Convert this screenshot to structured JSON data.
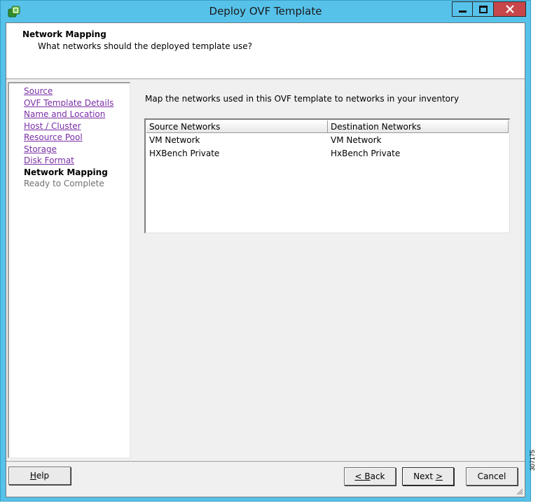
{
  "window": {
    "title": "Deploy OVF Template",
    "controls": {
      "minimize": "minimize",
      "maximize": "maximize",
      "close": "close"
    },
    "colors": {
      "titlebar": "#56c2ea",
      "close": "#c7464a",
      "link": "#7a2ea6"
    }
  },
  "header": {
    "title": "Network Mapping",
    "subtitle": "What networks should the deployed template use?"
  },
  "steps": [
    {
      "label": "Source",
      "state": "link"
    },
    {
      "label": "OVF Template Details",
      "state": "link"
    },
    {
      "label": "Name and Location",
      "state": "link"
    },
    {
      "label": "Host / Cluster",
      "state": "link"
    },
    {
      "label": "Resource Pool",
      "state": "link"
    },
    {
      "label": "Storage",
      "state": "link"
    },
    {
      "label": "Disk Format",
      "state": "link"
    },
    {
      "label": "Network Mapping",
      "state": "current"
    },
    {
      "label": "Ready to Complete",
      "state": "pending"
    }
  ],
  "content": {
    "instructions": "Map the networks used in this OVF template to networks in your inventory",
    "table": {
      "columns": [
        "Source Networks",
        "Destination Networks"
      ],
      "rows": [
        [
          "VM Network",
          "VM Network"
        ],
        [
          "HXBench Private",
          "HxBench Private"
        ]
      ]
    }
  },
  "buttons": {
    "help": {
      "mnemonic": "H",
      "rest": "elp"
    },
    "back": {
      "prefix": "< ",
      "mnemonic": "B",
      "rest": "ack"
    },
    "next": {
      "prefix": "Next ",
      "mnemonic": ">",
      "rest": ""
    },
    "cancel": "Cancel"
  },
  "figure_id": "307175"
}
